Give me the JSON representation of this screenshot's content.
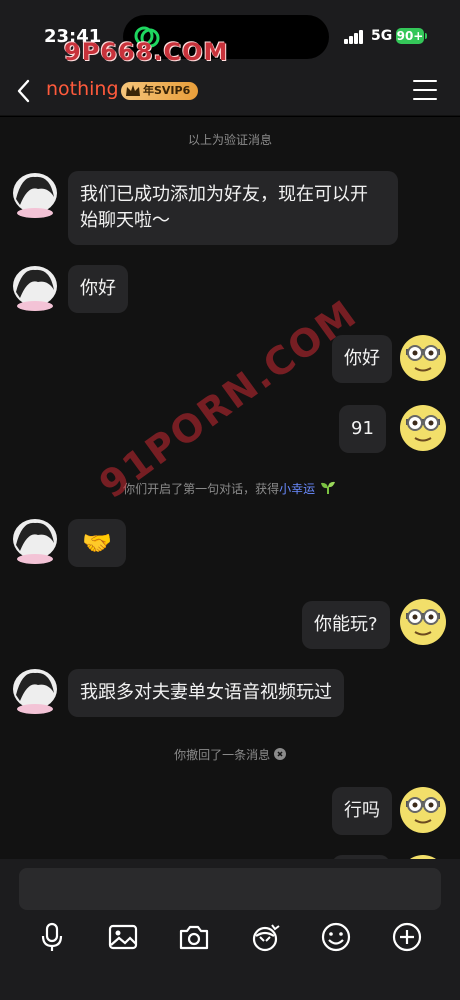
{
  "status": {
    "time": "23:41",
    "network": "5G",
    "battery": "90+"
  },
  "watermark": {
    "top": "9P668.COM",
    "diagonal": "91PORN.COM"
  },
  "nav": {
    "title": "nothing",
    "vip_badge": "年SVIP6"
  },
  "messages": [
    {
      "type": "system",
      "text": "以上为验证消息"
    },
    {
      "type": "incoming",
      "text_line1": "我们已成功添加为好友，现在可以开",
      "text_line2": "始聊天啦～"
    },
    {
      "type": "incoming",
      "text": "你好"
    },
    {
      "type": "outgoing",
      "text": "你好"
    },
    {
      "type": "outgoing",
      "text": "91"
    },
    {
      "type": "system",
      "text": "你们开启了第一句对话，获得",
      "highlight": "小幸运",
      "icon": "sprout-icon"
    },
    {
      "type": "incoming",
      "emoji": "🤝"
    },
    {
      "type": "outgoing",
      "text": "你能玩?"
    },
    {
      "type": "incoming",
      "text": "我跟多对夫妻单女语音视频玩过"
    },
    {
      "type": "system",
      "text": "你撤回了一条消息",
      "icon": "close-circle-icon"
    },
    {
      "type": "outgoing",
      "text": "行吗"
    }
  ],
  "toolbar": [
    "microphone-icon",
    "image-icon",
    "camera-icon",
    "gift-icon",
    "emoji-icon",
    "plus-icon"
  ],
  "colors": {
    "accent": "#ff5a3c",
    "battery": "#34c759",
    "highlight": "#6a8bff",
    "bubble": "#262628"
  }
}
